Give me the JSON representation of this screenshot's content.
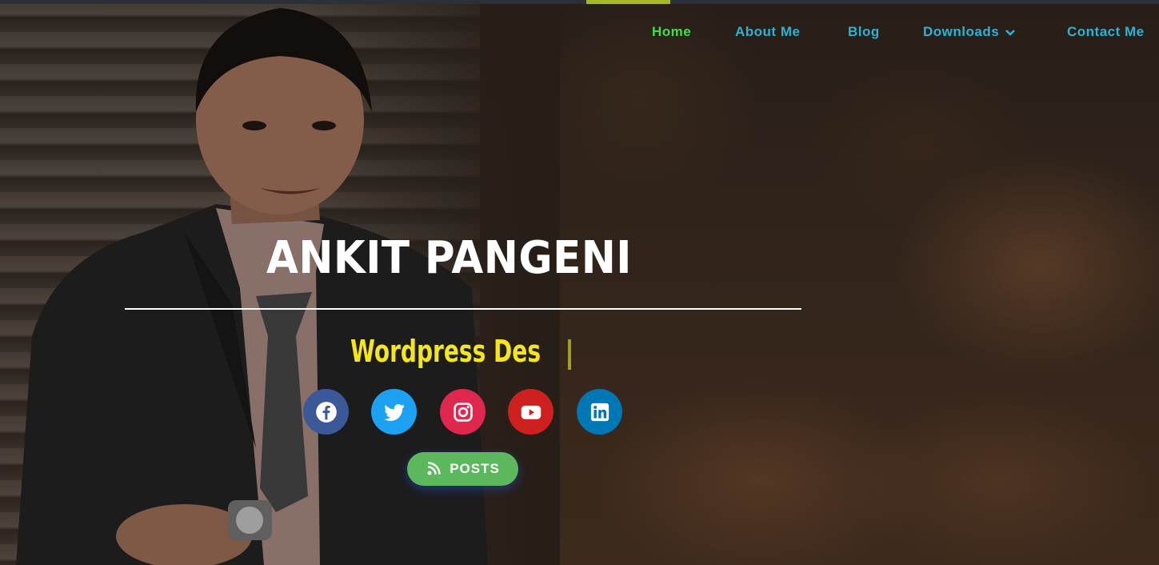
{
  "nav": {
    "items": [
      {
        "label": "Home",
        "active": true
      },
      {
        "label": "About Me"
      },
      {
        "label": "Blog"
      },
      {
        "label": "Downloads",
        "has_dropdown": true
      },
      {
        "label": "Contact Me"
      }
    ]
  },
  "hero": {
    "name": "ANKIT PANGENI",
    "role_typed": "Wordpress Des",
    "social": [
      {
        "icon": "facebook-icon",
        "color": "#3b5998"
      },
      {
        "icon": "twitter-icon",
        "color": "#1da1f2"
      },
      {
        "icon": "instagram-icon",
        "color": "#e0284f"
      },
      {
        "icon": "youtube-icon",
        "color": "#cd201f"
      },
      {
        "icon": "linkedin-icon",
        "color": "#0077b5"
      }
    ],
    "posts_button": {
      "label": "POSTS",
      "icon": "posts-icon",
      "color": "#5cb85c"
    }
  },
  "colors": {
    "nav_link": "#2bb3d6",
    "nav_active": "#3ee04a",
    "role_text": "#f4e61a",
    "accent_bar": "#a6b82a"
  }
}
